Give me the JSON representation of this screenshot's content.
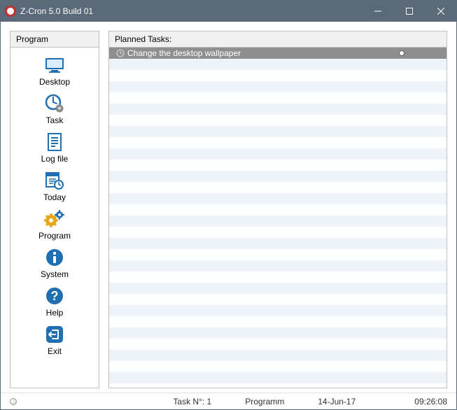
{
  "window": {
    "title": "Z-Cron 5.0 Build 01"
  },
  "sidebar": {
    "header": "Program",
    "items": [
      {
        "label": "Desktop",
        "icon": "desktop-icon"
      },
      {
        "label": "Task",
        "icon": "task-icon"
      },
      {
        "label": "Log file",
        "icon": "logfile-icon"
      },
      {
        "label": "Today",
        "icon": "today-icon"
      },
      {
        "label": "Program",
        "icon": "program-icon"
      },
      {
        "label": "System",
        "icon": "system-icon"
      },
      {
        "label": "Help",
        "icon": "help-icon"
      },
      {
        "label": "Exit",
        "icon": "exit-icon"
      }
    ]
  },
  "main": {
    "header": "Planned Tasks:",
    "tasks": [
      {
        "label": "Change the desktop wallpaper",
        "selected": true
      }
    ],
    "empty_row_count": 30
  },
  "statusbar": {
    "task_count": "Task N°: 1",
    "program": "Programm",
    "date": "14-Jun-17",
    "time": "09:26:08"
  },
  "colors": {
    "accent": "#1f6fb2",
    "titlebar": "#5a6a78"
  }
}
